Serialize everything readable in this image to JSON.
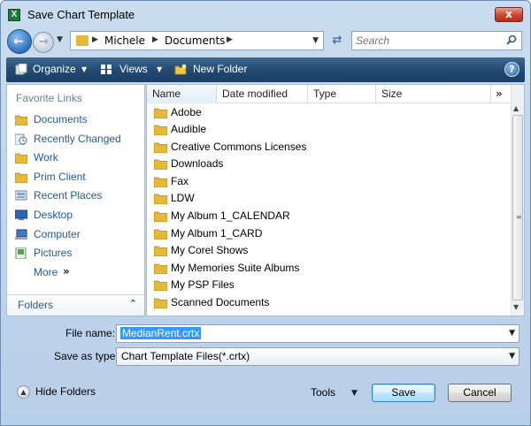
{
  "window": {
    "title": "Save Chart Template",
    "app_icon_letter": "X",
    "close_label": "x"
  },
  "address_bar": {
    "crumbs": [
      "Michele",
      "Documents"
    ]
  },
  "search": {
    "placeholder": "Search"
  },
  "command_bar": {
    "organize": "Organize",
    "views": "Views",
    "new_folder": "New Folder",
    "help": "?"
  },
  "nav_pane": {
    "header": "Favorite Links",
    "items": [
      {
        "label": "Documents",
        "icon": "folder-icon"
      },
      {
        "label": "Recently Changed",
        "icon": "recent-icon"
      },
      {
        "label": "Work",
        "icon": "folder-icon"
      },
      {
        "label": "Prim Client",
        "icon": "folder-icon"
      },
      {
        "label": "Recent Places",
        "icon": "places-icon"
      },
      {
        "label": "Desktop",
        "icon": "desktop-icon"
      },
      {
        "label": "Computer",
        "icon": "computer-icon"
      },
      {
        "label": "Pictures",
        "icon": "pictures-icon"
      }
    ],
    "more": "More",
    "more_arrows": "»",
    "folders": "Folders"
  },
  "file_list": {
    "columns": [
      "Name",
      "Date modified",
      "Type",
      "Size"
    ],
    "more_columns": "»",
    "items": [
      "Adobe",
      "Audible",
      "Creative Commons Licenses",
      "Downloads",
      "Fax",
      "LDW",
      "My Album 1_CALENDAR",
      "My Album 1_CARD",
      "My Corel Shows",
      "My Memories Suite Albums",
      "My PSP Files",
      "Scanned Documents"
    ]
  },
  "form": {
    "filename_label": "File name:",
    "filename_value": "MedianRent.crtx",
    "savetype_label": "Save as type:",
    "savetype_value": "Chart Template Files(*.crtx)"
  },
  "footer": {
    "hide_folders": "Hide Folders",
    "tools": "Tools",
    "save": "Save",
    "cancel": "Cancel"
  },
  "colors": {
    "link": "#1f5aa6",
    "command_bar": "#234a73",
    "folder": "#e7b93a",
    "selection": "#3399ff"
  }
}
